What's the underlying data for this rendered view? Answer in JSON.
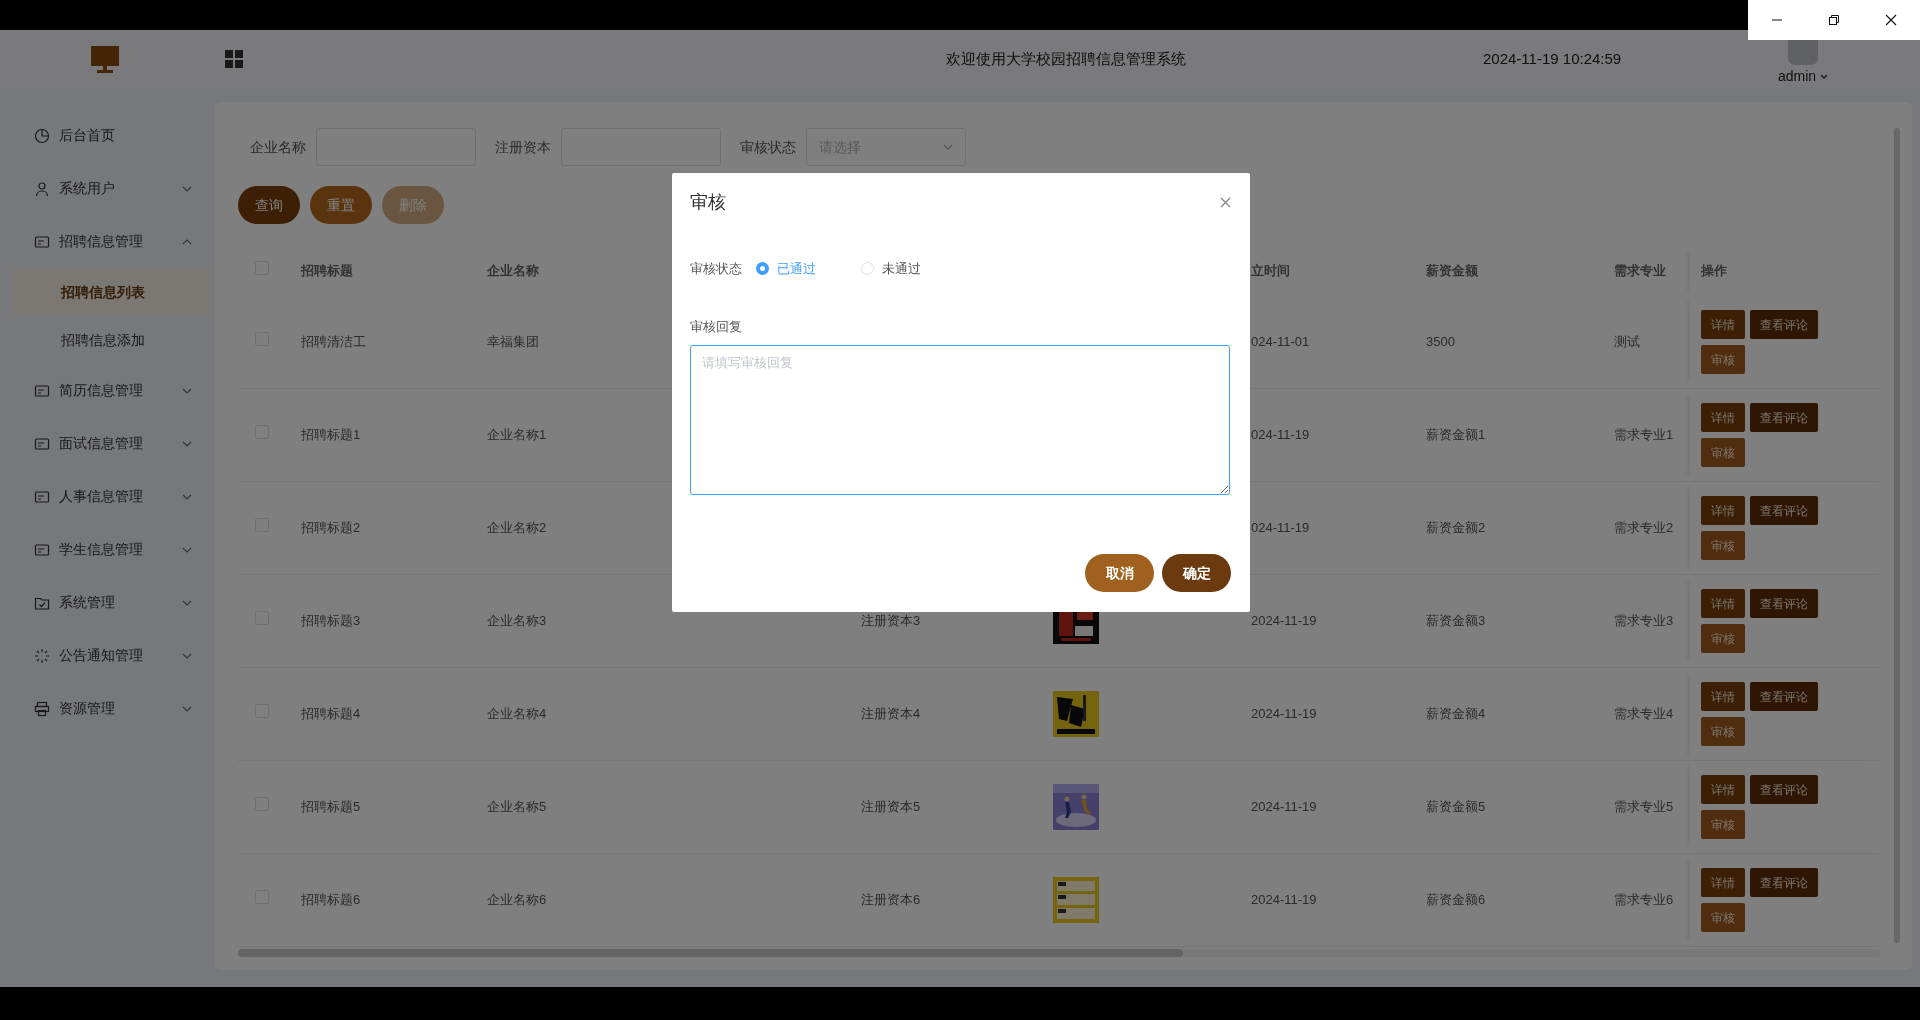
{
  "header": {
    "title": "欢迎使用大学校园招聘信息管理系统",
    "datetime": "2024-11-19 10:24:59",
    "user": "admin"
  },
  "sidebar": {
    "items": [
      {
        "label": "后台首页",
        "selected": false
      },
      {
        "label": "系统用户",
        "selected": false,
        "expanded": false
      },
      {
        "label": "招聘信息管理",
        "selected": false,
        "expanded": true,
        "children": [
          {
            "label": "招聘信息列表",
            "selected": true
          },
          {
            "label": "招聘信息添加",
            "selected": false
          }
        ]
      },
      {
        "label": "简历信息管理",
        "selected": false,
        "expanded": false
      },
      {
        "label": "面试信息管理",
        "selected": false,
        "expanded": false
      },
      {
        "label": "人事信息管理",
        "selected": false,
        "expanded": false
      },
      {
        "label": "学生信息管理",
        "selected": false,
        "expanded": false
      },
      {
        "label": "系统管理",
        "selected": false,
        "expanded": false
      },
      {
        "label": "公告通知管理",
        "selected": false,
        "expanded": false
      },
      {
        "label": "资源管理",
        "selected": false,
        "expanded": false
      }
    ]
  },
  "search": {
    "fields": [
      {
        "label": "企业名称",
        "kind": "input"
      },
      {
        "label": "注册资本",
        "kind": "input"
      },
      {
        "label": "审核状态",
        "kind": "select",
        "placeholder": "请选择"
      }
    ]
  },
  "buttons": [
    {
      "label": "查询",
      "kind": "primary",
      "disabled": false
    },
    {
      "label": "重置",
      "kind": "secondary",
      "disabled": false
    },
    {
      "label": "删除",
      "kind": "danger",
      "disabled": true
    }
  ],
  "table": {
    "header": {
      "checked": false,
      "title": "招聘标题",
      "company": "企业名称",
      "founded": "立时间",
      "salary": "薪资金额",
      "major": "需求专业",
      "actions": "操作"
    },
    "rows": [
      {
        "checked": false,
        "title": "招聘清洁工",
        "company": "幸福集团",
        "founded": "024-11-01",
        "salary": "3500",
        "major": "测试",
        "actions": [
          {
            "label": "详情",
            "kind": "detail"
          },
          {
            "label": "查看评论",
            "kind": "comments"
          },
          {
            "label": "审核",
            "kind": "review"
          }
        ]
      },
      {
        "checked": false,
        "title": "招聘标题1",
        "company": "企业名称1",
        "founded": "024-11-19",
        "salary": "薪资金额1",
        "major": "需求专业1",
        "actions": [
          {
            "label": "详情",
            "kind": "detail"
          },
          {
            "label": "查看评论",
            "kind": "comments"
          },
          {
            "label": "审核",
            "kind": "review"
          }
        ]
      },
      {
        "checked": false,
        "title": "招聘标题2",
        "company": "企业名称2",
        "founded": "024-11-19",
        "salary": "薪资金额2",
        "major": "需求专业2",
        "actions": [
          {
            "label": "详情",
            "kind": "detail"
          },
          {
            "label": "查看评论",
            "kind": "comments"
          },
          {
            "label": "审核",
            "kind": "review"
          }
        ]
      },
      {
        "checked": false,
        "title": "招聘标题3",
        "company": "企业名称3",
        "capital": "注册资本3",
        "founded": "2024-11-19",
        "salary": "薪资金额3",
        "major": "需求专业3",
        "actions": [
          {
            "label": "详情",
            "kind": "detail"
          },
          {
            "label": "查看评论",
            "kind": "comments"
          },
          {
            "label": "审核",
            "kind": "review"
          }
        ]
      },
      {
        "checked": false,
        "title": "招聘标题4",
        "company": "企业名称4",
        "capital": "注册资本4",
        "founded": "2024-11-19",
        "salary": "薪资金额4",
        "major": "需求专业4",
        "actions": [
          {
            "label": "详情",
            "kind": "detail"
          },
          {
            "label": "查看评论",
            "kind": "comments"
          },
          {
            "label": "审核",
            "kind": "review"
          }
        ]
      },
      {
        "checked": false,
        "title": "招聘标题5",
        "company": "企业名称5",
        "capital": "注册资本5",
        "founded": "2024-11-19",
        "salary": "薪资金额5",
        "major": "需求专业5",
        "actions": [
          {
            "label": "详情",
            "kind": "detail"
          },
          {
            "label": "查看评论",
            "kind": "comments"
          },
          {
            "label": "审核",
            "kind": "review"
          }
        ]
      },
      {
        "checked": false,
        "title": "招聘标题6",
        "company": "企业名称6",
        "capital": "注册资本6",
        "founded": "2024-11-19",
        "salary": "薪资金额6",
        "major": "需求专业6",
        "actions": [
          {
            "label": "详情",
            "kind": "detail"
          },
          {
            "label": "查看评论",
            "kind": "comments"
          },
          {
            "label": "审核",
            "kind": "review"
          }
        ]
      }
    ]
  },
  "modal": {
    "title": "审核",
    "status": {
      "label": "审核状态",
      "options": [
        {
          "label": "已通过",
          "selected": true
        },
        {
          "label": "未通过",
          "selected": false
        }
      ]
    },
    "reply": {
      "label": "审核回复",
      "placeholder": "请填写审核回复"
    },
    "buttons": [
      {
        "label": "取消",
        "kind": "cancel"
      },
      {
        "label": "确定",
        "kind": "confirm"
      }
    ]
  }
}
